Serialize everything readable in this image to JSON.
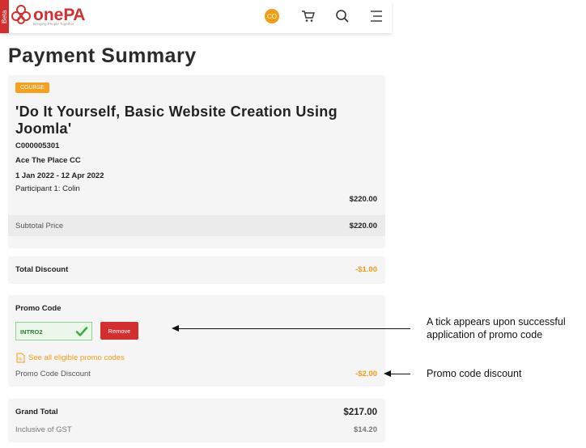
{
  "header": {
    "beta_label": "Beta",
    "logo_one": "one",
    "logo_pa": "PA",
    "tagline": "Bringing People Together",
    "avatar_initials": "CO"
  },
  "page_title": "Payment Summary",
  "course": {
    "badge": "COURSE",
    "title": "'Do It Yourself, Basic Website Creation Using Joomla'",
    "code": "C000005301",
    "venue": "Ace The Place CC",
    "dates": "1 Jan 2022 - 12 Apr 2022",
    "participant": "Participant 1: Colin",
    "price": "$220.00",
    "subtotal_label": "Subtotal Price",
    "subtotal_value": "$220.00"
  },
  "discount": {
    "label": "Total Discount",
    "value": "-$1.00"
  },
  "promo": {
    "label": "Promo Code",
    "code_value": "INTRO2",
    "remove_label": "Remove",
    "eligible_link": "See all eligible promo codes",
    "discount_label": "Promo Code Discount",
    "discount_value": "-$2.00"
  },
  "grand": {
    "label": "Grand Total",
    "value": "$217.00",
    "gst_label": "Inclusive of GST",
    "gst_value": "$14.20"
  },
  "annotations": {
    "tick_note_line1": "A tick appears upon successful",
    "tick_note_line2": "application of promo code",
    "discount_note": "Promo code discount"
  },
  "colors": {
    "brand_red": "#d32f2f",
    "accent_orange": "#f39c12",
    "success_green": "#2e7d32"
  }
}
